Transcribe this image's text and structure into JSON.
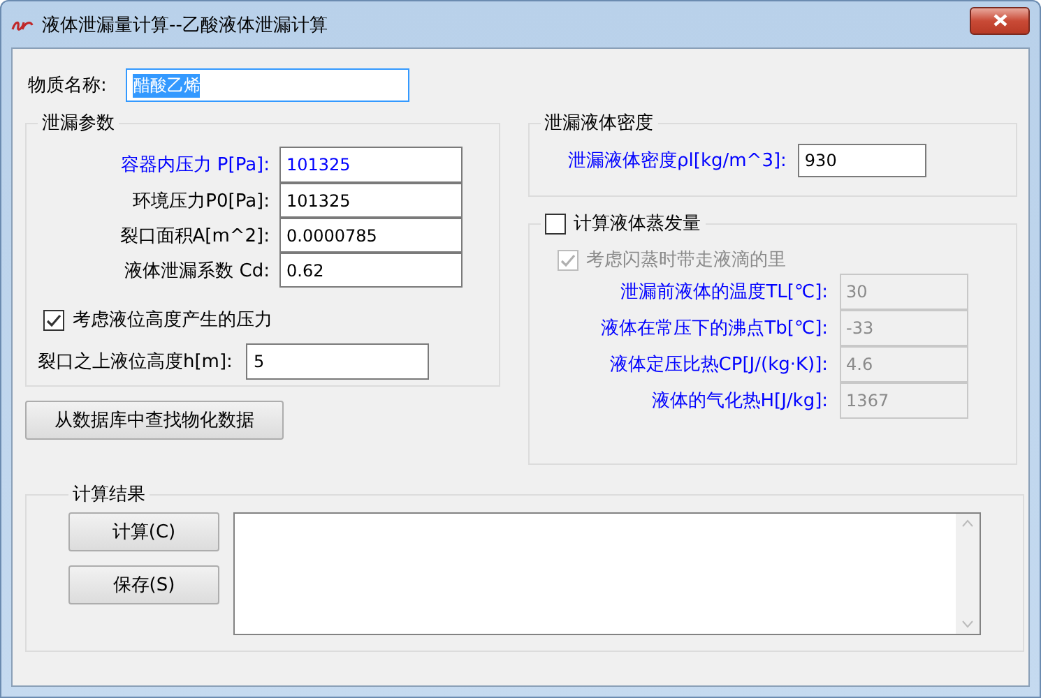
{
  "window": {
    "title": "液体泄漏量计算--乙酸液体泄漏计算"
  },
  "substance": {
    "label": "物质名称:",
    "value": "醋酸乙烯",
    "selected": true
  },
  "leak_params": {
    "title": "泄漏参数",
    "fields": [
      {
        "label": "容器内压力 P[Pa]:",
        "value": "101325",
        "color": "#0000ff"
      },
      {
        "label": "环境压力P0[Pa]:",
        "value": "101325",
        "color": "#000000"
      },
      {
        "label": "裂口面积A[m^2]:",
        "value": "0.0000785",
        "color": "#000000"
      },
      {
        "label": "液体泄漏系数  Cd:",
        "value": "0.62",
        "color": "#000000"
      }
    ],
    "level_pressure": {
      "label": "考虑液位高度产生的压力",
      "checked": true
    },
    "height_field": {
      "label": "裂口之上液位高度h[m]:",
      "value": "5"
    }
  },
  "lookup_button": "从数据库中查找物化数据",
  "density": {
    "title": "泄漏液体密度",
    "field": {
      "label": "泄漏液体密度ρl[kg/m^3]:",
      "value": "930"
    }
  },
  "evaporation": {
    "label": "计算液体蒸发量",
    "checked": false,
    "droplets": {
      "label": "考虑闪蒸时带走液滴的里",
      "checked": true,
      "disabled": true
    },
    "fields": [
      {
        "label": "泄漏前液体的温度TL[℃]:",
        "value": "30",
        "disabled": true
      },
      {
        "label": "液体在常压下的沸点Tb[℃]:",
        "value": "-33",
        "disabled": true
      },
      {
        "label": "液体定压比热CP[J/(kg·K)]:",
        "value": "4.6",
        "disabled": true
      },
      {
        "label": "液体的气化热H[J/kg]:",
        "value": "1367",
        "disabled": true
      }
    ]
  },
  "results": {
    "title": "计算结果",
    "buttons": [
      "计算(C)",
      "保存(S)"
    ]
  }
}
